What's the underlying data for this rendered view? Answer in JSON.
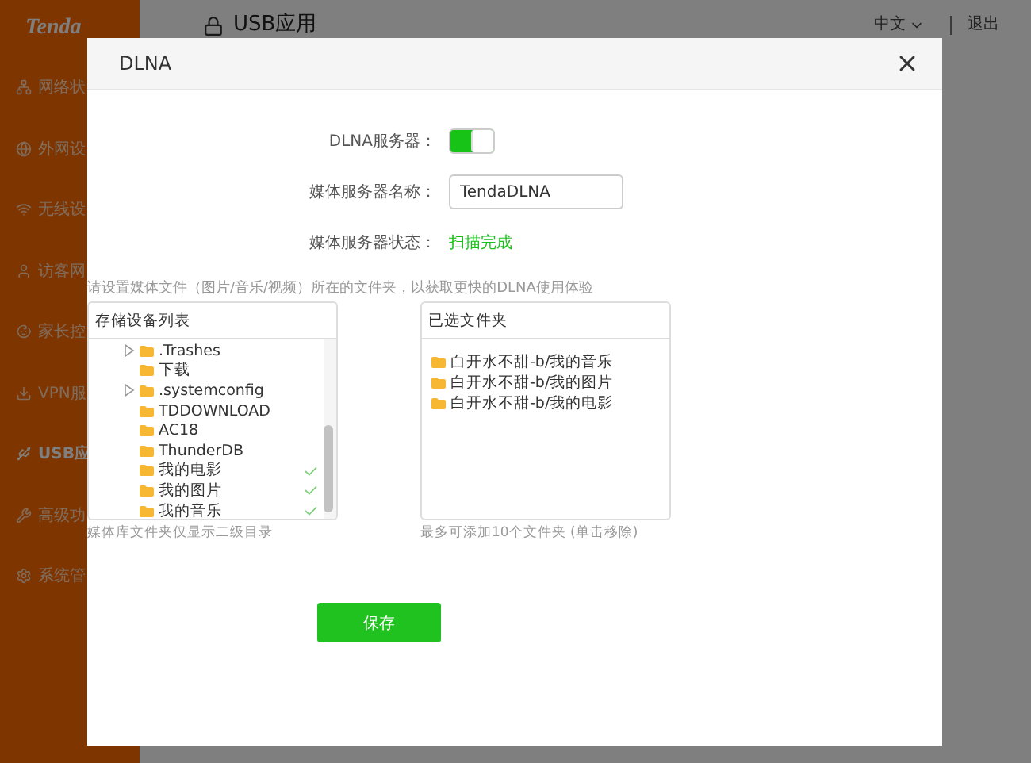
{
  "brand": "Tenda",
  "page_title": "USB应用",
  "language": "中文",
  "logout": "退出",
  "sidebar": {
    "items": [
      {
        "label": "网络状",
        "selected": false
      },
      {
        "label": "外网设",
        "selected": false
      },
      {
        "label": "无线设",
        "selected": false
      },
      {
        "label": "访客网",
        "selected": false
      },
      {
        "label": "家长控",
        "selected": false
      },
      {
        "label": "VPN服",
        "selected": false
      },
      {
        "label": "USB应",
        "selected": true
      },
      {
        "label": "高级功",
        "selected": false
      },
      {
        "label": "系统管",
        "selected": false
      }
    ]
  },
  "dialog": {
    "title": "DLNA",
    "fields": [
      {
        "kind": "switch",
        "label": "DLNA服务器：",
        "on": true
      },
      {
        "kind": "input",
        "label": "媒体服务器名称：",
        "value": "TendaDLNA"
      },
      {
        "kind": "status",
        "label": "媒体服务器状态：",
        "value": "扫描完成"
      }
    ],
    "hint": "请设置媒体文件（图片/音乐/视频）所在的文件夹，以获取更快的DLNA使用体验",
    "device_list": {
      "title": "存储设备列表",
      "items": [
        {
          "name": ".Trashes",
          "expandable": true,
          "checked": false
        },
        {
          "name": "下载",
          "expandable": false,
          "checked": false
        },
        {
          "name": ".systemconfig",
          "expandable": true,
          "checked": false
        },
        {
          "name": "TDDOWNLOAD",
          "expandable": false,
          "checked": false
        },
        {
          "name": "AC18",
          "expandable": false,
          "checked": false
        },
        {
          "name": "ThunderDB",
          "expandable": false,
          "checked": false
        },
        {
          "name": "我的电影",
          "expandable": false,
          "checked": true
        },
        {
          "name": "我的图片",
          "expandable": false,
          "checked": true
        },
        {
          "name": "我的音乐",
          "expandable": false,
          "checked": true
        }
      ],
      "note": "媒体库文件夹仅显示二级目录"
    },
    "selected_list": {
      "title": "已选文件夹",
      "items": [
        "白开水不甜-b/我的音乐",
        "白开水不甜-b/我的图片",
        "白开水不甜-b/我的电影"
      ],
      "note": "最多可添加10个文件夹 (单击移除)"
    },
    "save": "保存"
  }
}
